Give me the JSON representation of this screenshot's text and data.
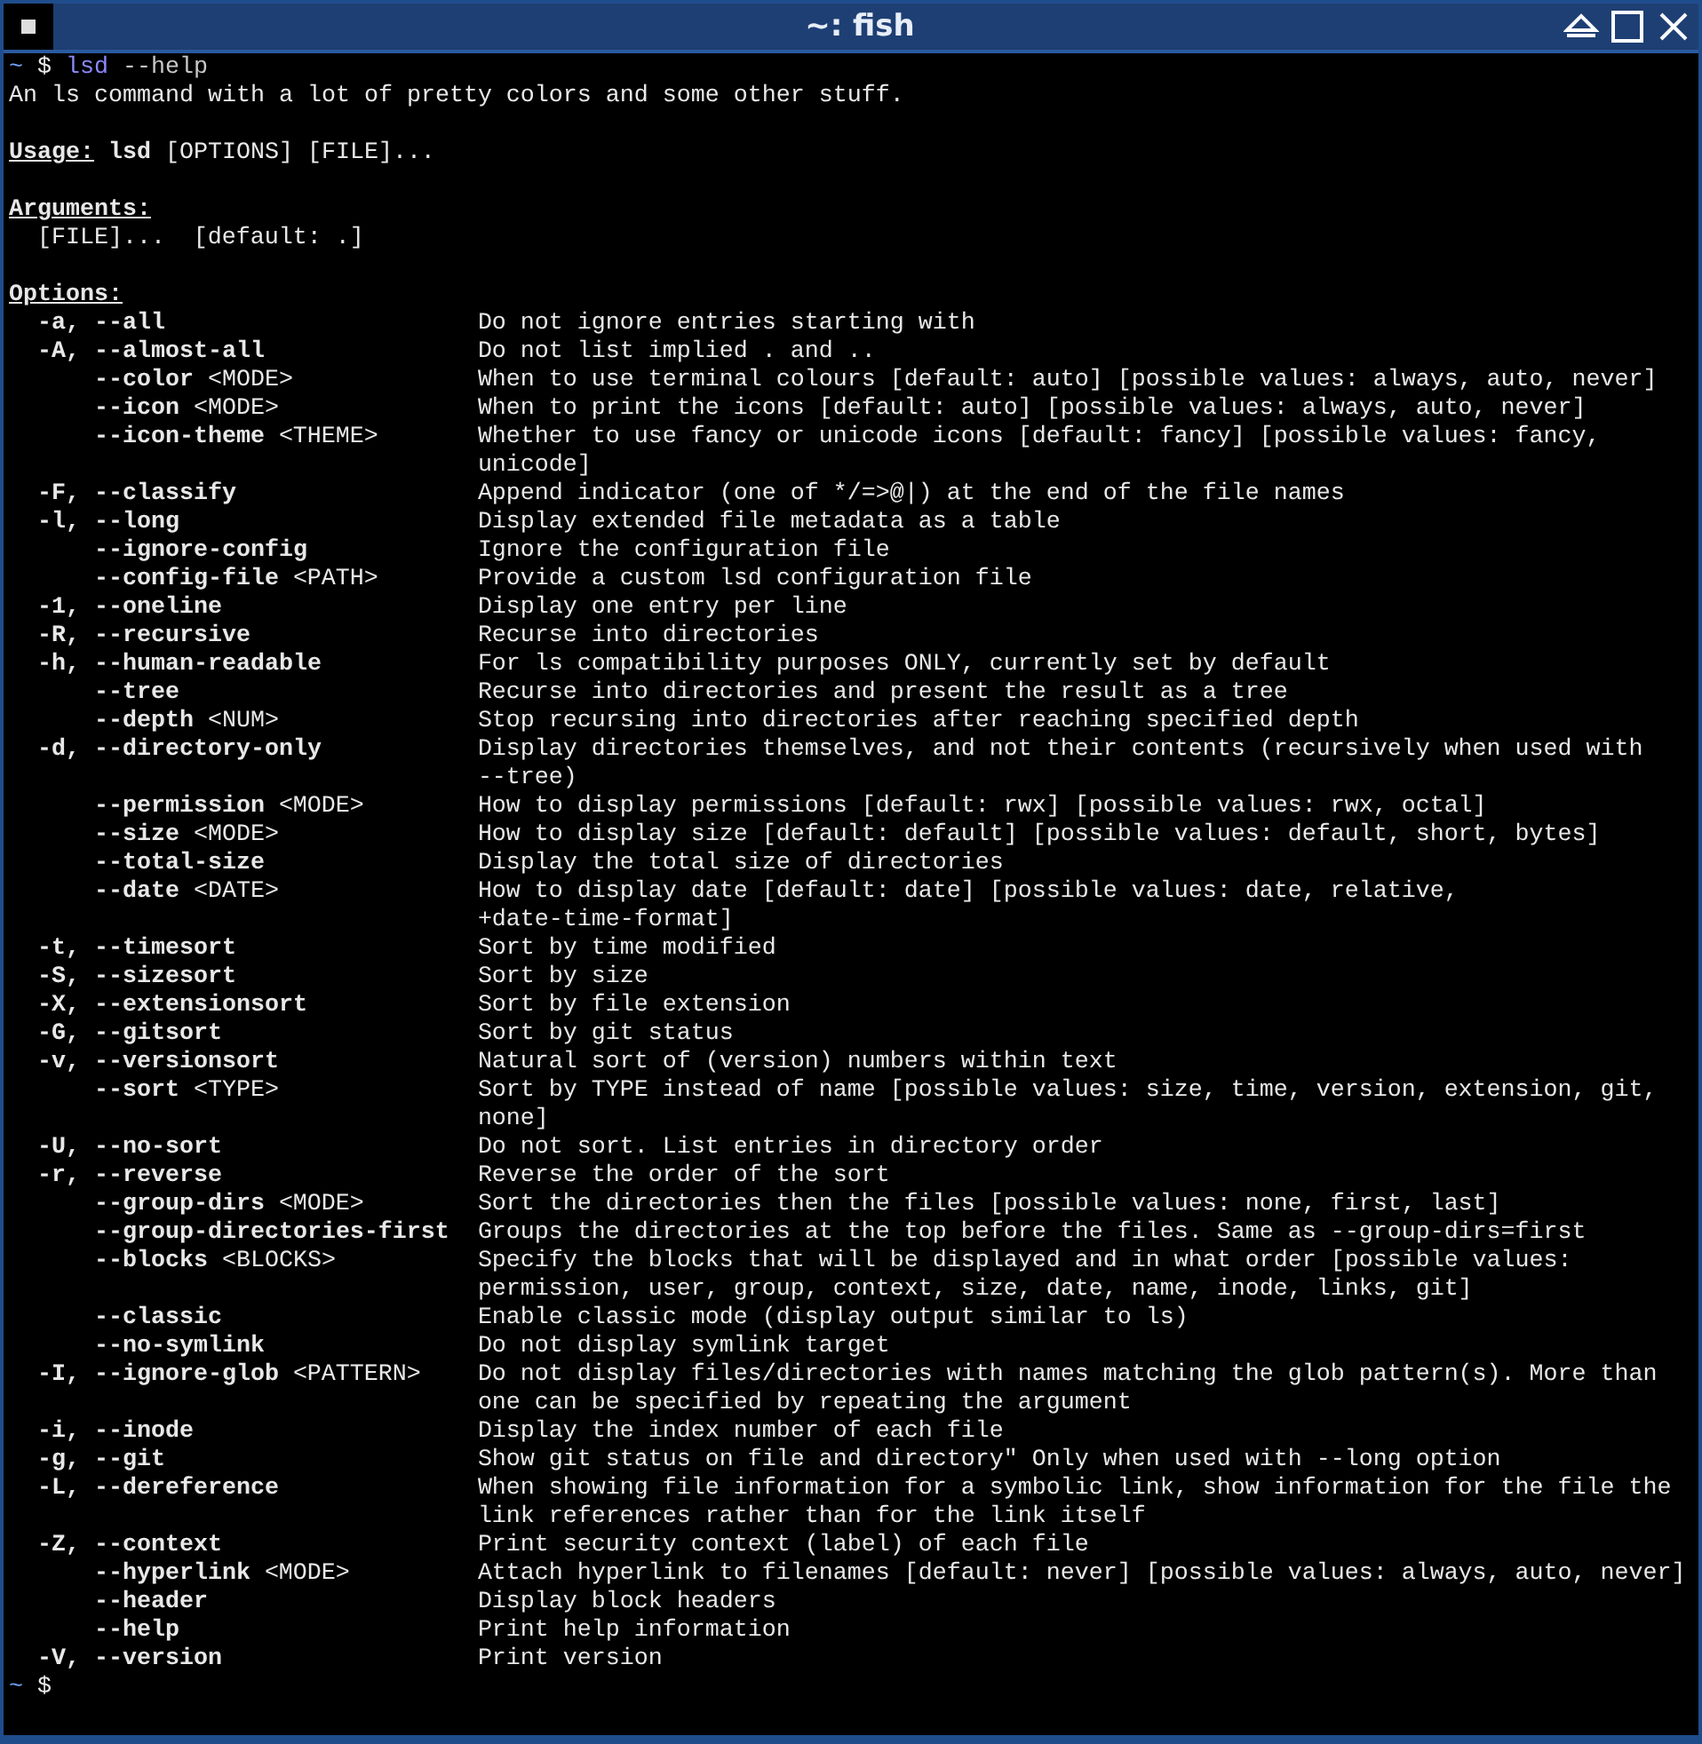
{
  "window": {
    "title": "~: fish"
  },
  "terminal": {
    "command": {
      "dir": "~",
      "symbol": "$",
      "program": "lsd",
      "args": "--help"
    },
    "about": "An ls command with a lot of pretty colors and some other stuff.",
    "usage": {
      "label": "Usage:",
      "program": "lsd",
      "args": "[OPTIONS] [FILE]..."
    },
    "arguments": {
      "heading": "Arguments:",
      "items": [
        {
          "name": "[FILE]...",
          "default": "[default: .]"
        }
      ]
    },
    "options": {
      "heading": "Options:",
      "items": [
        {
          "short": "-a,",
          "long": "--all",
          "lines": [
            "Do not ignore entries starting with"
          ]
        },
        {
          "short": "-A,",
          "long": "--almost-all",
          "lines": [
            "Do not list implied . and .."
          ]
        },
        {
          "long": "--color",
          "arg": "<MODE>",
          "lines": [
            "When to use terminal colours [default: auto] [possible values: always, auto, never]"
          ]
        },
        {
          "long": "--icon",
          "arg": "<MODE>",
          "lines": [
            "When to print the icons [default: auto] [possible values: always, auto, never]"
          ]
        },
        {
          "long": "--icon-theme",
          "arg": "<THEME>",
          "lines": [
            "Whether to use fancy or unicode icons [default: fancy] [possible values: fancy,",
            "unicode]"
          ]
        },
        {
          "short": "-F,",
          "long": "--classify",
          "lines": [
            "Append indicator (one of */=>@|) at the end of the file names"
          ]
        },
        {
          "short": "-l,",
          "long": "--long",
          "lines": [
            "Display extended file metadata as a table"
          ]
        },
        {
          "long": "--ignore-config",
          "lines": [
            "Ignore the configuration file"
          ]
        },
        {
          "long": "--config-file",
          "arg": "<PATH>",
          "lines": [
            "Provide a custom lsd configuration file"
          ]
        },
        {
          "short": "-1,",
          "long": "--oneline",
          "lines": [
            "Display one entry per line"
          ]
        },
        {
          "short": "-R,",
          "long": "--recursive",
          "lines": [
            "Recurse into directories"
          ]
        },
        {
          "short": "-h,",
          "long": "--human-readable",
          "lines": [
            "For ls compatibility purposes ONLY, currently set by default"
          ]
        },
        {
          "long": "--tree",
          "lines": [
            "Recurse into directories and present the result as a tree"
          ]
        },
        {
          "long": "--depth",
          "arg": "<NUM>",
          "lines": [
            "Stop recursing into directories after reaching specified depth"
          ]
        },
        {
          "short": "-d,",
          "long": "--directory-only",
          "lines": [
            "Display directories themselves, and not their contents (recursively when used with",
            "--tree)"
          ]
        },
        {
          "long": "--permission",
          "arg": "<MODE>",
          "lines": [
            "How to display permissions [default: rwx] [possible values: rwx, octal]"
          ]
        },
        {
          "long": "--size",
          "arg": "<MODE>",
          "lines": [
            "How to display size [default: default] [possible values: default, short, bytes]"
          ]
        },
        {
          "long": "--total-size",
          "lines": [
            "Display the total size of directories"
          ]
        },
        {
          "long": "--date",
          "arg": "<DATE>",
          "lines": [
            "How to display date [default: date] [possible values: date, relative,",
            "+date-time-format]"
          ]
        },
        {
          "short": "-t,",
          "long": "--timesort",
          "lines": [
            "Sort by time modified"
          ]
        },
        {
          "short": "-S,",
          "long": "--sizesort",
          "lines": [
            "Sort by size"
          ]
        },
        {
          "short": "-X,",
          "long": "--extensionsort",
          "lines": [
            "Sort by file extension"
          ]
        },
        {
          "short": "-G,",
          "long": "--gitsort",
          "lines": [
            "Sort by git status"
          ]
        },
        {
          "short": "-v,",
          "long": "--versionsort",
          "lines": [
            "Natural sort of (version) numbers within text"
          ]
        },
        {
          "long": "--sort",
          "arg": "<TYPE>",
          "lines": [
            "Sort by TYPE instead of name [possible values: size, time, version, extension, git,",
            "none]"
          ]
        },
        {
          "short": "-U,",
          "long": "--no-sort",
          "lines": [
            "Do not sort. List entries in directory order"
          ]
        },
        {
          "short": "-r,",
          "long": "--reverse",
          "lines": [
            "Reverse the order of the sort"
          ]
        },
        {
          "long": "--group-dirs",
          "arg": "<MODE>",
          "lines": [
            "Sort the directories then the files [possible values: none, first, last]"
          ]
        },
        {
          "long": "--group-directories-first",
          "lines": [
            "Groups the directories at the top before the files. Same as --group-dirs=first"
          ]
        },
        {
          "long": "--blocks",
          "arg": "<BLOCKS>",
          "lines": [
            "Specify the blocks that will be displayed and in what order [possible values:",
            "permission, user, group, context, size, date, name, inode, links, git]"
          ]
        },
        {
          "long": "--classic",
          "lines": [
            "Enable classic mode (display output similar to ls)"
          ]
        },
        {
          "long": "--no-symlink",
          "lines": [
            "Do not display symlink target"
          ]
        },
        {
          "short": "-I,",
          "long": "--ignore-glob",
          "arg": "<PATTERN>",
          "lines": [
            "Do not display files/directories with names matching the glob pattern(s). More than",
            "one can be specified by repeating the argument"
          ]
        },
        {
          "short": "-i,",
          "long": "--inode",
          "lines": [
            "Display the index number of each file"
          ]
        },
        {
          "short": "-g,",
          "long": "--git",
          "lines": [
            "Show git status on file and directory\" Only when used with --long option"
          ]
        },
        {
          "short": "-L,",
          "long": "--dereference",
          "lines": [
            "When showing file information for a symbolic link, show information for the file the",
            "link references rather than for the link itself"
          ]
        },
        {
          "short": "-Z,",
          "long": "--context",
          "lines": [
            "Print security context (label) of each file"
          ]
        },
        {
          "long": "--hyperlink",
          "arg": "<MODE>",
          "lines": [
            "Attach hyperlink to filenames [default: never] [possible values: always, auto, never]"
          ]
        },
        {
          "long": "--header",
          "lines": [
            "Display block headers"
          ]
        },
        {
          "long": "--help",
          "lines": [
            "Print help information"
          ]
        },
        {
          "short": "-V,",
          "long": "--version",
          "lines": [
            "Print version"
          ]
        }
      ]
    },
    "final_prompt": {
      "dir": "~",
      "symbol": "$"
    }
  }
}
